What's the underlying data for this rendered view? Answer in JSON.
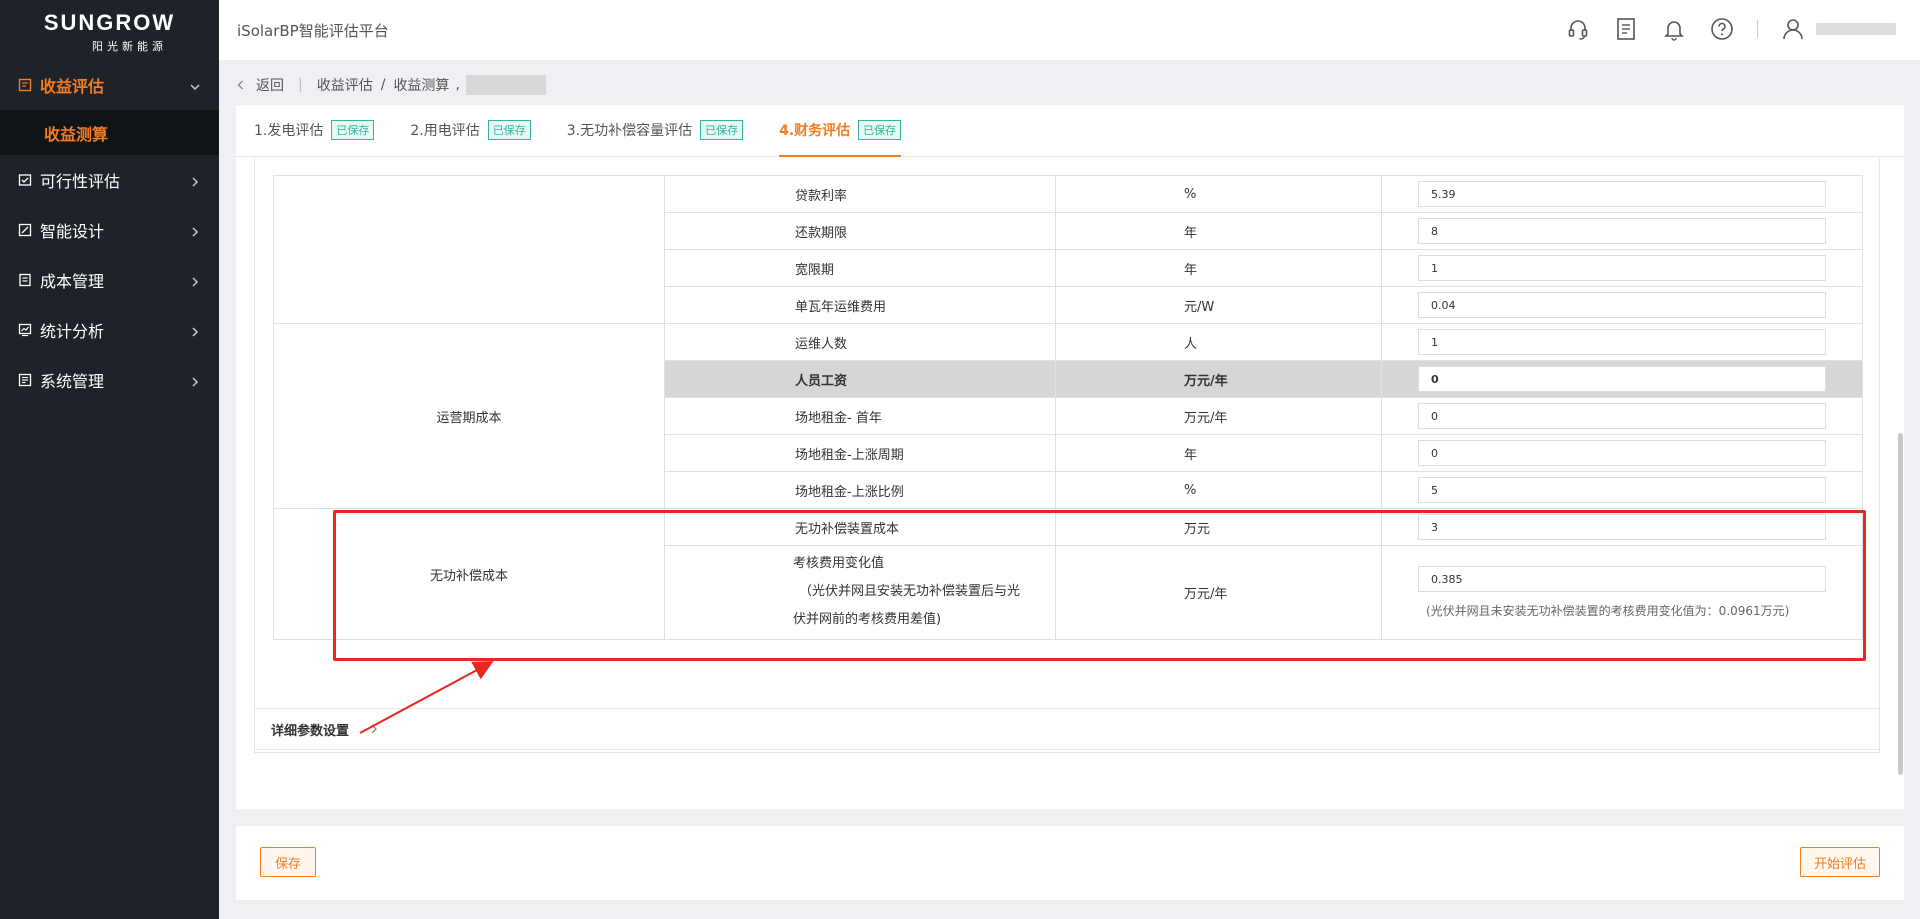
{
  "brand": {
    "name": "SUNGROW",
    "sub": "阳光新能源"
  },
  "app_title": "iSolarBP智能评估平台",
  "sidebar": {
    "items": [
      {
        "label": "收益评估",
        "icon": "report-icon",
        "active": true
      },
      {
        "label": "可行性评估",
        "icon": "checklist-icon"
      },
      {
        "label": "智能设计",
        "icon": "design-icon"
      },
      {
        "label": "成本管理",
        "icon": "ledger-icon"
      },
      {
        "label": "统计分析",
        "icon": "chart-icon"
      },
      {
        "label": "系统管理",
        "icon": "document-icon"
      }
    ],
    "sub_item": "收益测算"
  },
  "breadcrumb": {
    "back": "返回",
    "level1": "收益评估",
    "level2": "收益测算",
    "tail": ","
  },
  "tabs": [
    {
      "label": "1.发电评估",
      "badge": "已保存"
    },
    {
      "label": "2.用电评估",
      "badge": "已保存"
    },
    {
      "label": "3.无功补偿容量评估",
      "badge": "已保存"
    },
    {
      "label": "4.财务评估",
      "badge": "已保存",
      "active": true
    }
  ],
  "table": {
    "rows": [
      {
        "name": "贷款利率",
        "unit": "%",
        "value": "5.39"
      },
      {
        "name": "还款期限",
        "unit": "年",
        "value": "8"
      },
      {
        "name": "宽限期",
        "unit": "年",
        "value": "1"
      },
      {
        "name": "单瓦年运维费用",
        "unit": "元/W",
        "value": "0.04"
      },
      {
        "name": "运维人数",
        "unit": "人",
        "value": "1"
      },
      {
        "name": "人员工资",
        "unit": "万元/年",
        "value": "0"
      },
      {
        "name": "场地租金- 首年",
        "unit": "万元/年",
        "value": "0"
      },
      {
        "name": "场地租金-上涨周期",
        "unit": "年",
        "value": "0"
      },
      {
        "name": "场地租金-上涨比例",
        "unit": "%",
        "value": "5"
      },
      {
        "name": "无功补偿装置成本",
        "unit": "万元",
        "value": "3"
      }
    ],
    "group_operating": "运营期成本",
    "group_reactive": "无功补偿成本",
    "assess": {
      "name_line1": "考核费用变化值",
      "name_line2": "（光伏并网且安装无功补偿装置后与光",
      "name_line3": "伏并网前的考核费用差值)",
      "unit": "万元/年",
      "value": "0.385",
      "hint": "(光伏并网且未安装无功补偿装置的考核费用变化值为：0.0961万元)"
    }
  },
  "detail_label": "详细参数设置",
  "footer": {
    "save": "保存",
    "start": "开始评估"
  },
  "colors": {
    "accent": "#f47b20",
    "sidebar_bg": "#1e2329",
    "saved_badge": "#33b59c",
    "annotation": "#e8281f"
  }
}
